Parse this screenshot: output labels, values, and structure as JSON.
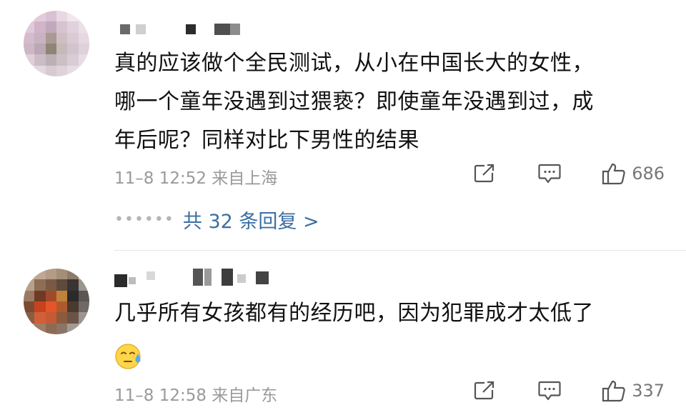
{
  "comments": [
    {
      "text_lines": [
        "真的应该做个全民测试，从小在中国长大的女性，",
        "哪一个童年没遇到过猥亵？即使童年没遇到过，成",
        "年后呢？同样对比下男性的结果"
      ],
      "meta": "11–8 12:52 来自上海",
      "likes": "686",
      "replies_label": "共 32 条回复 >"
    },
    {
      "text_lines": [
        "几乎所有女孩都有的经历吧，因为犯罪成才太低了"
      ],
      "meta": "11–8 12:58 来自广东",
      "likes": "337"
    }
  ],
  "icons": {
    "share": "share-icon",
    "reply": "reply-icon",
    "like": "thumbs-up-icon",
    "emoji": "sweat-face-emoji"
  },
  "colors": {
    "link": "#3c6ea3",
    "meta": "#9a9a9a",
    "text": "#111111"
  }
}
